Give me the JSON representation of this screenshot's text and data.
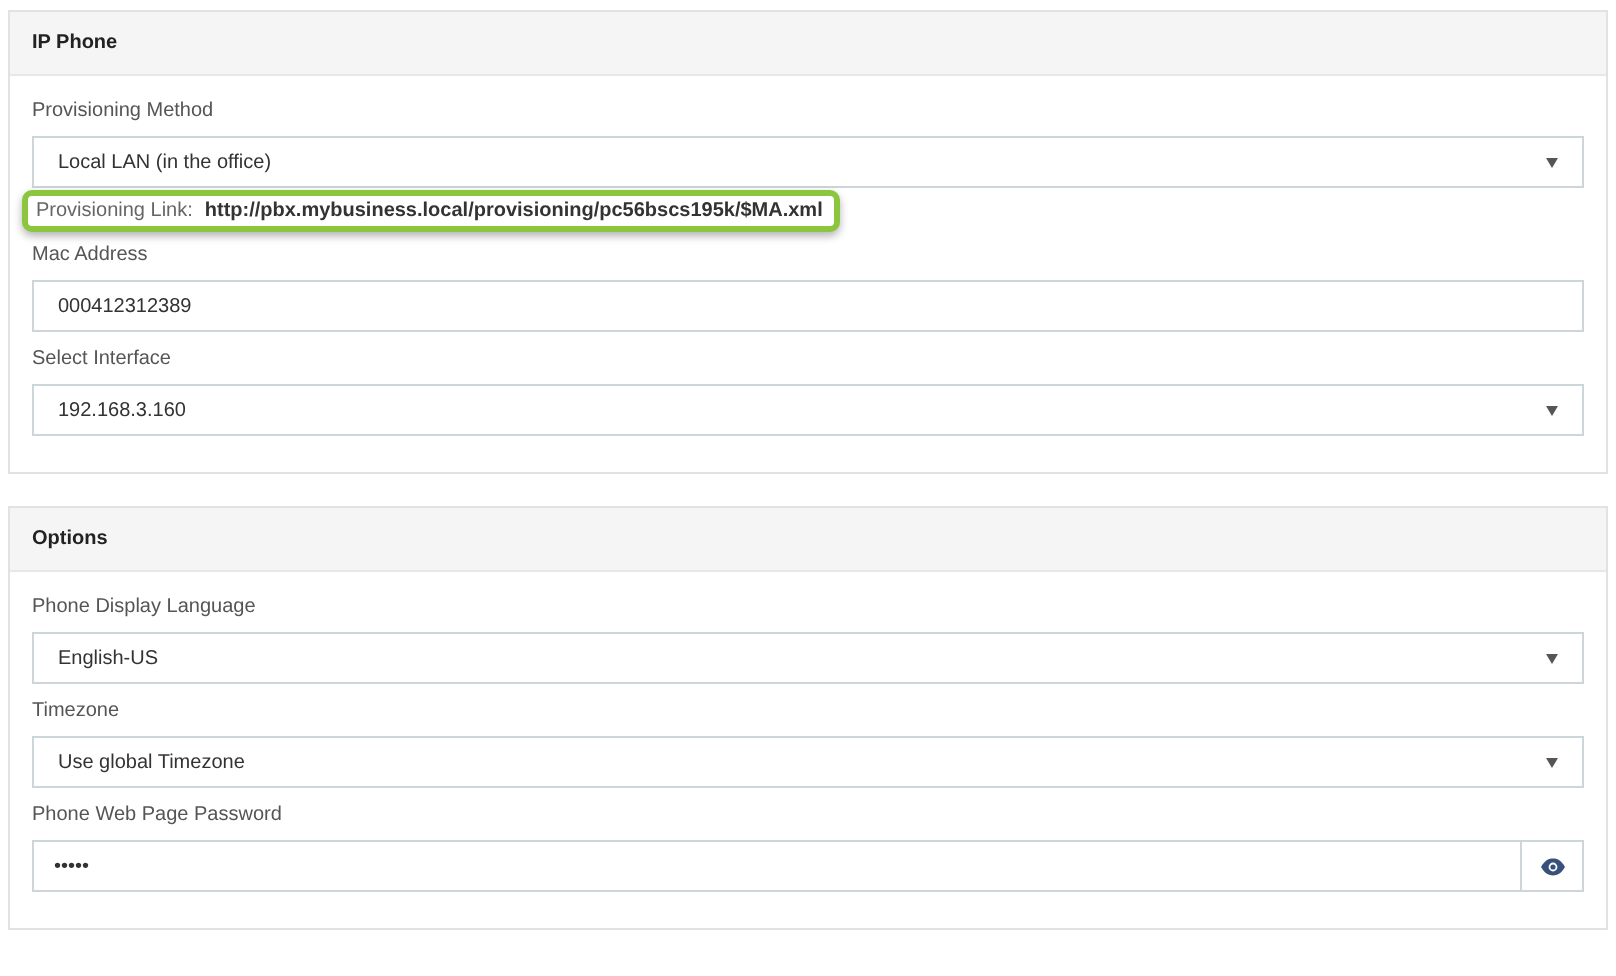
{
  "panels": [
    {
      "title": "IP Phone",
      "fields": [
        {
          "kind": "select",
          "label": "Provisioning Method",
          "value": "Local LAN (in the office)"
        },
        {
          "kind": "link",
          "label": "Provisioning Link:",
          "value": "http://pbx.mybusiness.local/provisioning/pc56bscs195k/$MA.xml"
        },
        {
          "kind": "text",
          "label": "Mac Address",
          "value": "000412312389"
        },
        {
          "kind": "select",
          "label": "Select Interface",
          "value": "192.168.3.160"
        }
      ]
    },
    {
      "title": "Options",
      "fields": [
        {
          "kind": "select",
          "label": "Phone Display Language",
          "value": "English-US"
        },
        {
          "kind": "select",
          "label": "Timezone",
          "value": "Use global Timezone"
        },
        {
          "kind": "password",
          "label": "Phone Web Page Password",
          "value": "•••••"
        }
      ]
    }
  ]
}
